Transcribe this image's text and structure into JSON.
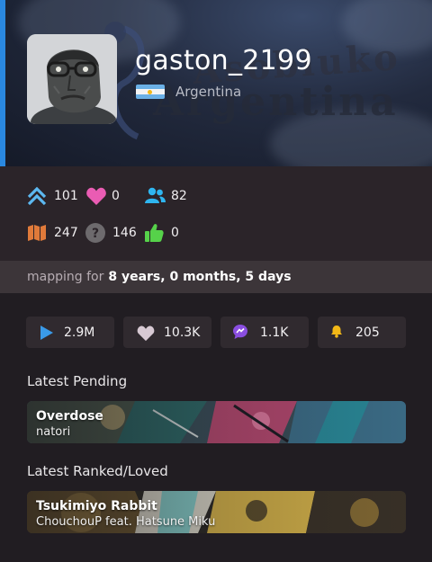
{
  "profile": {
    "username": "gaston_2199",
    "country": "Argentina",
    "background_words": [
      "Asobiuko",
      "Argentina"
    ]
  },
  "stats": {
    "ranked_up": "101",
    "favourites": "0",
    "followers": "82",
    "beatmaps": "247",
    "unknown": "146",
    "kudosu": "0"
  },
  "mapping": {
    "label": "mapping for",
    "duration": "8 years, 0 months, 5 days"
  },
  "counters": {
    "plays": "2.9M",
    "favourites": "10.3K",
    "comments": "1.1K",
    "subscribers": "205"
  },
  "latest_pending": {
    "heading": "Latest Pending",
    "title": "Overdose",
    "artist": "natori"
  },
  "latest_ranked": {
    "heading": "Latest Ranked/Loved",
    "title": "Tsukimiyo Rabbit",
    "artist": "ChouchouP feat. Hatsune Miku"
  },
  "colors": {
    "accent": "#2a88e0",
    "background": "#211d22",
    "stats_panel": "#2b2429",
    "ranked_icon": "#5cb8f0",
    "favourite_icon": "#ea5cb3",
    "followers_icon": "#2fb6f0",
    "beatmaps_icon": "#e07a3a",
    "kudosu_icon": "#56d24a",
    "play_icon": "#3a9ae8",
    "comment_icon": "#8a4ee0",
    "bell_icon": "#f2b817"
  }
}
